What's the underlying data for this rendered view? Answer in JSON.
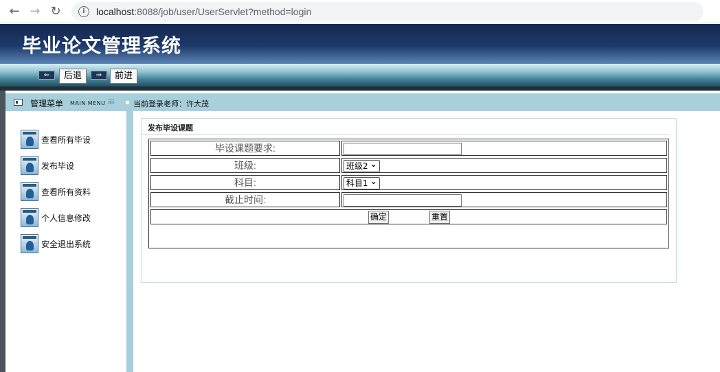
{
  "browser": {
    "url_host": "localhost",
    "url_rest": ":8088/job/user/UserServlet?method=login",
    "back_icon": "←",
    "forward_icon": "→",
    "reload_icon": "↻",
    "info_icon": "i"
  },
  "header": {
    "title": "毕业论文管理系统"
  },
  "toolbar": {
    "back_label": "后退",
    "forward_label": "前进",
    "back_arrow": "⇐",
    "forward_arrow": "⇒"
  },
  "menu": {
    "title": "管理菜单",
    "title_en": "MAIN MENU",
    "lines_icon": "≡",
    "login_info": "当前登录老师：许大茂"
  },
  "sidebar": {
    "items": [
      {
        "label": "查看所有毕设"
      },
      {
        "label": "发布毕设"
      },
      {
        "label": "查看所有资料"
      },
      {
        "label": "个人信息修改"
      },
      {
        "label": "安全退出系统"
      }
    ]
  },
  "panel": {
    "title": "发布毕设课题"
  },
  "form": {
    "requirement_label": "毕设课题要求:",
    "requirement_value": "",
    "class_label": "班级:",
    "class_selected": "班级2",
    "subject_label": "科目:",
    "subject_selected": "科目1",
    "deadline_label": "截止时间:",
    "deadline_value": "",
    "confirm_label": "确定",
    "reset_label": "重置"
  }
}
